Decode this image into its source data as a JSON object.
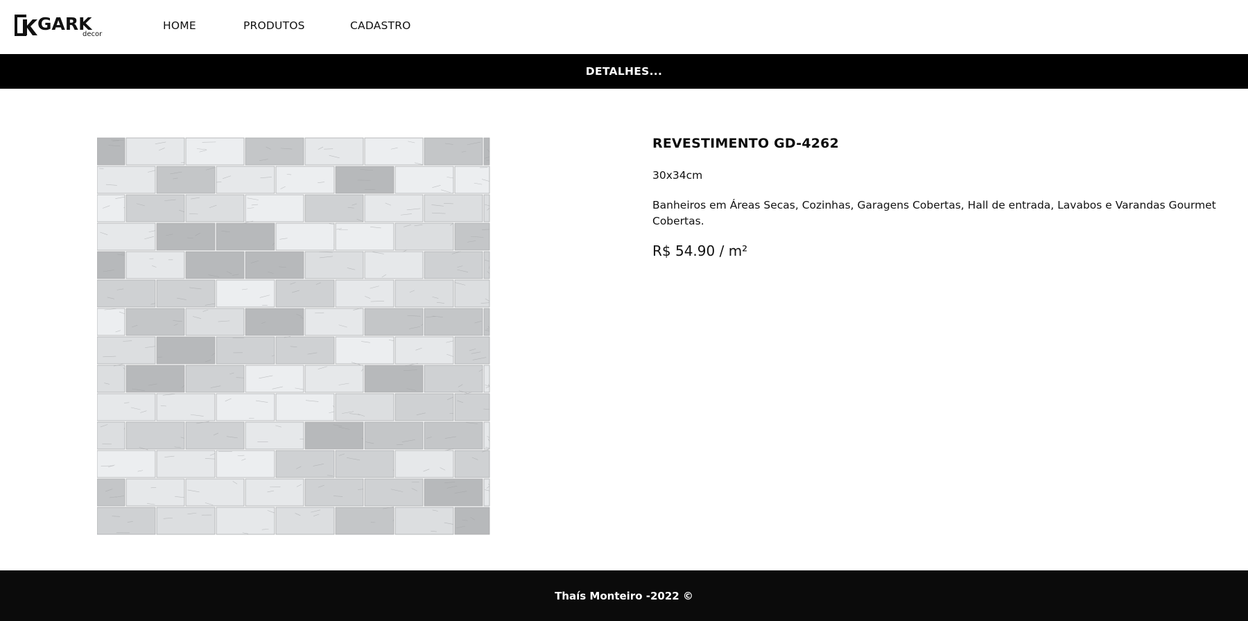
{
  "header": {
    "logo_text": "GARK",
    "logo_subtext": "decor",
    "nav": [
      {
        "label": "HOME"
      },
      {
        "label": "PRODUTOS"
      },
      {
        "label": "CADASTRO"
      }
    ]
  },
  "banner": {
    "title": "DETALHES..."
  },
  "product": {
    "image_alt": "mosaic-stone-tile",
    "title": "REVESTIMENTO GD-4262",
    "size": "30x34cm",
    "description": "Banheiros em Áreas Secas, Cozinhas, Garagens Cobertas, Hall de entrada, Lavabos e Varandas Gourmet Cobertas.",
    "price": "R$ 54.90 / m²"
  },
  "footer": {
    "text": "Thaís Monteiro -2022 ©"
  },
  "colors": {
    "banner_bg": "#000000",
    "footer_bg": "#0b0b0b",
    "stone_light": "#e6e8ea",
    "stone_mid": "#cfd1d3",
    "stone_dark": "#b7b9bb"
  }
}
